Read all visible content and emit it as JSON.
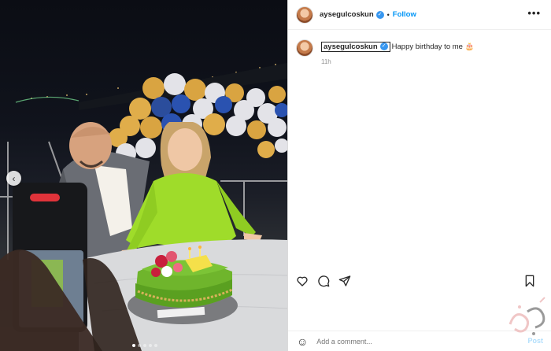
{
  "post": {
    "username": "aysegulcoskun",
    "verified_icon": "verified-badge-icon",
    "separator": "•",
    "follow_label": "Follow",
    "more_icon": "more-options-icon",
    "more_glyph": "•••",
    "caption_text": "Happy birthday to me 🎂",
    "time_ago": "11h"
  },
  "photo": {
    "prev_glyph": "‹",
    "carousel_count": 5,
    "carousel_active": 0
  },
  "actions": {
    "like_icon": "heart-icon",
    "comment_icon": "comment-icon",
    "share_icon": "share-icon",
    "save_icon": "bookmark-icon"
  },
  "comment_box": {
    "emoji_icon": "emoji-icon",
    "placeholder": "Add a comment...",
    "post_label": "Post"
  },
  "colors": {
    "accent": "#0095f6",
    "verified": "#3897f0",
    "dress": "#9fdc2a",
    "cake": "#6fb52c"
  }
}
